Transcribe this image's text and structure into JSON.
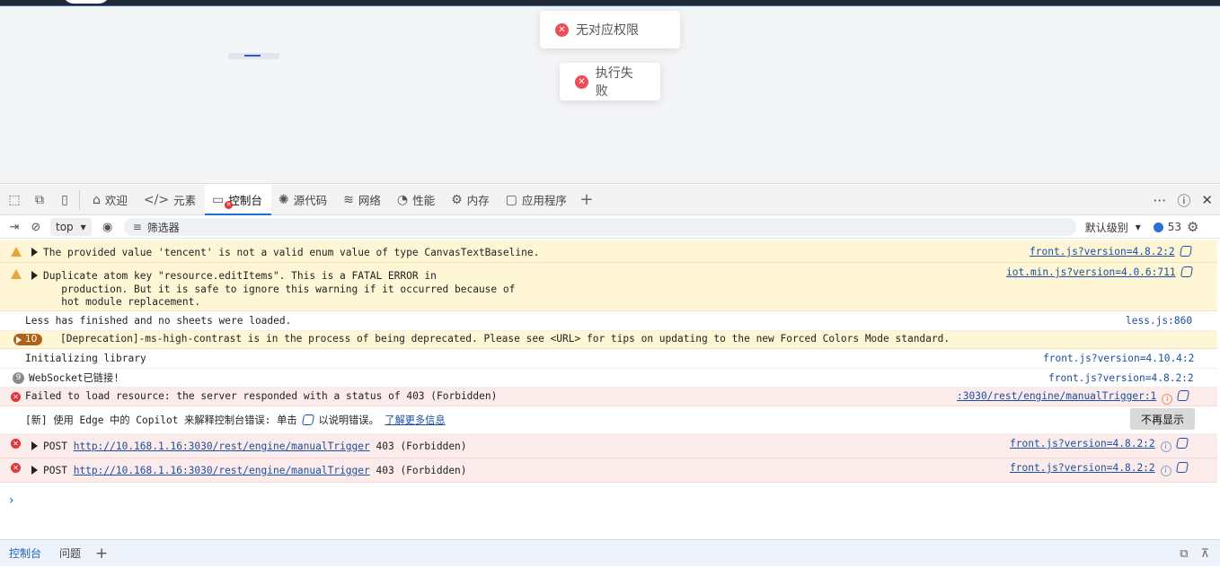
{
  "toasts": {
    "first": "无对应权限",
    "second": "执行失败"
  },
  "devtools": {
    "tabs": {
      "welcome": "欢迎",
      "elements": "元素",
      "console": "控制台",
      "sources": "源代码",
      "network": "网络",
      "performance": "性能",
      "memory": "内存",
      "application": "应用程序"
    },
    "console_bar": {
      "context": "top",
      "filter_placeholder": "筛选器",
      "level": "默认级别",
      "message_count": "53"
    },
    "messages": [
      {
        "type": "warning",
        "text": "The provided value 'tencent' is not a valid enum value of type CanvasTextBaseline.",
        "source": "front.js?version=4.8.2:2"
      },
      {
        "type": "warning",
        "text": "Duplicate atom key \"resource.editItems\". This is a FATAL ERROR in\n   production. But it is safe to ignore this warning if it occurred because of\n   hot module replacement.",
        "source": "iot.min.js?version=4.0.6:711"
      },
      {
        "type": "log",
        "text": "Less has finished and no sheets were loaded.",
        "source": "less.js:860"
      },
      {
        "type": "warning-group",
        "count": "10",
        "text": "[Deprecation]-ms-high-contrast is in the process of being deprecated. Please see <URL> for tips on updating to the new Forced Colors Mode standard."
      },
      {
        "type": "log",
        "text": "Initializing library",
        "source": "front.js?version=4.10.4:2"
      },
      {
        "type": "log-repeat",
        "count": "9",
        "text": "WebSocket已链接!",
        "source": "front.js?version=4.8.2:2"
      },
      {
        "type": "error",
        "text": "Failed to load resource: the server responded with a status of 403 (Forbidden)",
        "source": ":3030/rest/engine/manualTrigger:1"
      },
      {
        "type": "copilot",
        "text_before": "[新] 使用 Edge 中的 Copilot 来解释控制台错误: 单击",
        "text_after": "以说明错误。",
        "link": "了解更多信息",
        "button": "不再显示"
      },
      {
        "type": "error",
        "method": "POST",
        "url": "http://10.168.1.16:3030/rest/engine/manualTrigger",
        "status": "403 (Forbidden)",
        "source": "front.js?version=4.8.2:2"
      },
      {
        "type": "error",
        "method": "POST",
        "url": "http://10.168.1.16:3030/rest/engine/manualTrigger",
        "status": "403 (Forbidden)",
        "source": "front.js?version=4.8.2:2"
      }
    ],
    "drawer": {
      "console": "控制台",
      "issues": "问题"
    }
  }
}
